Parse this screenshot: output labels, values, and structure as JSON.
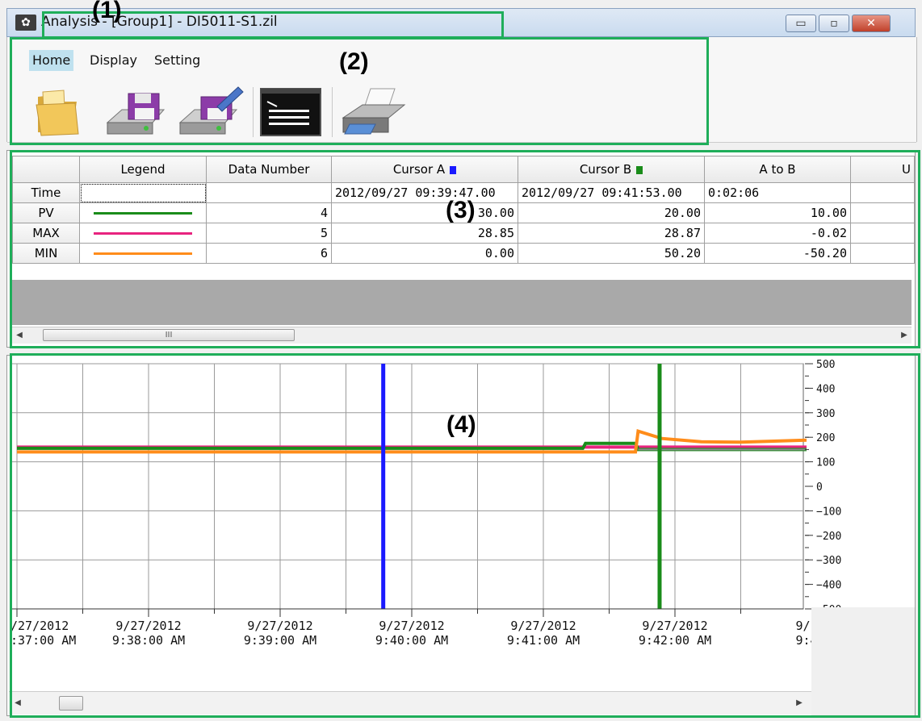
{
  "window": {
    "title": "Analysis - [Group1] - DI5011-S1.zil",
    "app_icon": "app-logo-icon",
    "buttons": {
      "minimize": "▭",
      "maximize": "▫",
      "close": "✕"
    }
  },
  "menu": {
    "home": "Home",
    "display": "Display",
    "setting": "Setting"
  },
  "toolbar": {
    "icons": [
      "open-folder-icon",
      "save-icon",
      "save-as-icon",
      "console-icon",
      "print-icon"
    ]
  },
  "table": {
    "headers": [
      "",
      "Legend",
      "Data Number",
      "Cursor A",
      "Cursor B",
      "A to B",
      "U"
    ],
    "rows": [
      {
        "name": "Time",
        "legend_color": "",
        "data_number": "",
        "cursor_a": "2012/09/27 09:39:47.00",
        "cursor_b": "2012/09/27 09:41:53.00",
        "a_to_b": "0:02:06"
      },
      {
        "name": "PV",
        "legend_color": "#1a8c1a",
        "data_number": "4",
        "cursor_a": "30.00",
        "cursor_b": "20.00",
        "a_to_b": "10.00"
      },
      {
        "name": "MAX",
        "legend_color": "#e8237f",
        "data_number": "5",
        "cursor_a": "28.85",
        "cursor_b": "28.87",
        "a_to_b": "-0.02"
      },
      {
        "name": "MIN",
        "legend_color": "#ff8c1a",
        "data_number": "6",
        "cursor_a": "0.00",
        "cursor_b": "50.20",
        "a_to_b": "-50.20"
      }
    ],
    "cursor_a_color": "#1a1aff",
    "cursor_b_color": "#1a8c1a",
    "scroll_thumb_label": "III"
  },
  "chart_data": {
    "type": "line",
    "x_ticks": [
      {
        "date": "/27/2012",
        "time": ":37:00 AM"
      },
      {
        "date": "9/27/2012",
        "time": "9:38:00 AM"
      },
      {
        "date": "9/27/2012",
        "time": "9:39:00 AM"
      },
      {
        "date": "9/27/2012",
        "time": "9:40:00 AM"
      },
      {
        "date": "9/27/2012",
        "time": "9:41:00 AM"
      },
      {
        "date": "9/27/2012",
        "time": "9:42:00 AM"
      },
      {
        "date": "9/:",
        "time": "9:4"
      }
    ],
    "y_ticks": [
      "500",
      "400",
      "300",
      "200",
      "100",
      "0",
      "−100",
      "−200",
      "−300",
      "−400",
      "−500"
    ],
    "ylim": [
      -500,
      500
    ],
    "grid": true,
    "cursor_a_time": "09:39:47",
    "cursor_b_time": "09:41:53",
    "series": [
      {
        "color": "#e8237f",
        "values": [
          [
            0,
            160
          ],
          [
            1,
            160
          ],
          [
            2,
            160
          ],
          [
            3,
            160
          ],
          [
            4,
            160
          ],
          [
            4.8,
            160
          ],
          [
            5.5,
            160
          ],
          [
            6,
            160
          ]
        ]
      },
      {
        "color": "#1a8c1a",
        "values": [
          [
            0,
            155
          ],
          [
            4,
            155
          ],
          [
            4.3,
            155
          ],
          [
            4.32,
            175
          ],
          [
            4.7,
            175
          ],
          [
            4.72,
            150
          ],
          [
            6,
            150
          ]
        ]
      },
      {
        "color": "#ff8c1a",
        "values": [
          [
            0,
            140
          ],
          [
            4.7,
            140
          ],
          [
            4.72,
            225
          ],
          [
            4.9,
            195
          ],
          [
            5.2,
            182
          ],
          [
            5.5,
            180
          ],
          [
            6,
            188
          ]
        ]
      },
      {
        "color": "#8a8a8a",
        "values": [
          [
            4.72,
            150
          ],
          [
            6,
            150
          ]
        ]
      }
    ]
  },
  "annotations": [
    "(1)",
    "(2)",
    "(3)",
    "(4)"
  ]
}
